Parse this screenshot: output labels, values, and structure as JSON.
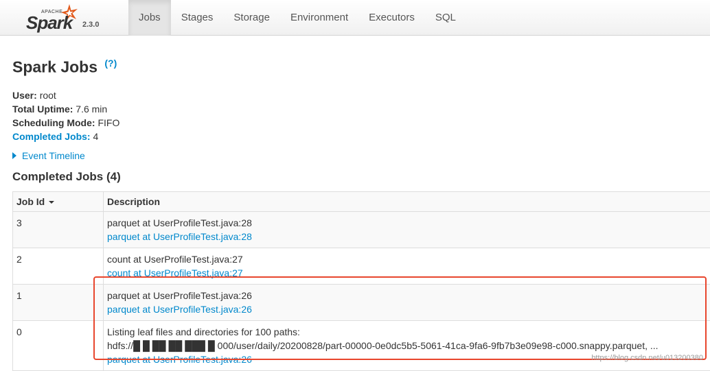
{
  "brand": {
    "apache": "APACHE",
    "name": "Spark",
    "version": "2.3.0"
  },
  "nav": {
    "tabs": [
      {
        "label": "Jobs",
        "active": true
      },
      {
        "label": "Stages"
      },
      {
        "label": "Storage"
      },
      {
        "label": "Environment"
      },
      {
        "label": "Executors"
      },
      {
        "label": "SQL"
      }
    ]
  },
  "page": {
    "title": "Spark Jobs",
    "help": "(?)"
  },
  "summary": {
    "user_label": "User:",
    "user": "root",
    "uptime_label": "Total Uptime:",
    "uptime": "7.6 min",
    "scheduling_label": "Scheduling Mode:",
    "scheduling": "FIFO",
    "completed_label": "Completed Jobs:",
    "completed": "4"
  },
  "timeline": {
    "label": "Event Timeline"
  },
  "section": {
    "title": "Completed Jobs (4)"
  },
  "table": {
    "headers": [
      "Job Id",
      "Description"
    ],
    "rows": [
      {
        "id": "3",
        "desc": "parquet at UserProfileTest.java:28",
        "link": "parquet at UserProfileTest.java:28"
      },
      {
        "id": "2",
        "desc": "count at UserProfileTest.java:27",
        "link": "count at UserProfileTest.java:27"
      },
      {
        "id": "1",
        "desc": "parquet at UserProfileTest.java:26",
        "link": "parquet at UserProfileTest.java:26"
      },
      {
        "id": "0",
        "desc": "Listing leaf files and directories for 100 paths:",
        "desc2": "hdfs://█ █ ██ ██ ███ █ 000/user/daily/20200828/part-00000-0e0dc5b5-5061-41ca-9fa6-9fb7b3e09e98-c000.snappy.parquet, ...",
        "link": "parquet at UserProfileTest.java:26"
      }
    ]
  },
  "watermark": "https://blog.csdn.net/u013200380",
  "colors": {
    "link": "#0088cc",
    "highlight": "#e8452c"
  }
}
